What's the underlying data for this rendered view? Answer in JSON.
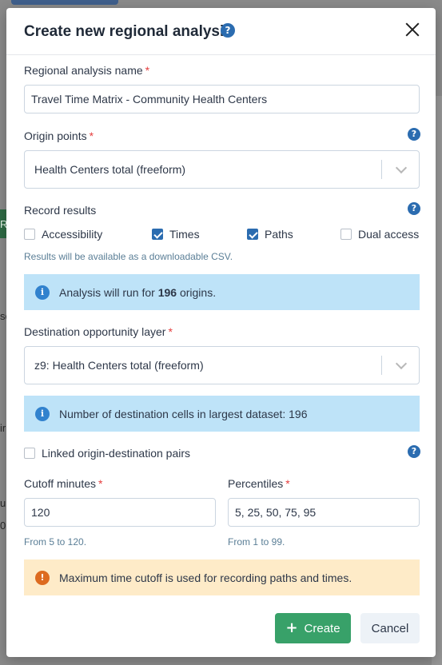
{
  "modal": {
    "title": "Create new regional analysis",
    "name_label": "Regional analysis name",
    "name_value": "Travel Time Matrix - Community Health Centers",
    "origin_label": "Origin points",
    "origin_value": "Health Centers total (freeform)",
    "record_label": "Record results",
    "checkboxes": [
      {
        "label": "Accessibility",
        "checked": false
      },
      {
        "label": "Times",
        "checked": true
      },
      {
        "label": "Paths",
        "checked": true
      },
      {
        "label": "Dual access",
        "checked": false
      }
    ],
    "record_hint": "Results will be available as a downloadable CSV.",
    "origins_info_prefix": "Analysis will run for ",
    "origins_info_count": "196",
    "origins_info_suffix": " origins.",
    "destination_label": "Destination opportunity layer",
    "destination_value": "z9: Health Centers total (freeform)",
    "destination_info": "Number of destination cells in largest dataset: 196",
    "linked_label": "Linked origin-destination pairs",
    "cutoff_label": "Cutoff minutes",
    "cutoff_value": "120",
    "cutoff_hint": "From 5 to 120.",
    "percentiles_label": "Percentiles",
    "percentiles_value": "5, 25, 50, 75, 95",
    "percentiles_hint": "From 1 to 99.",
    "warning": "Maximum time cutoff is used for recording paths and times.",
    "create_label": "Create",
    "cancel_label": "Cancel",
    "required_mark": "*",
    "help_glyph": "?",
    "info_glyph": "i",
    "warn_glyph": "!"
  },
  "background": {
    "fragments": [
      "R",
      "se",
      "ir",
      "ul",
      "0"
    ]
  },
  "colors": {
    "primary": "#2b6cb0",
    "success": "#38a169",
    "info_bg": "#bee3f8",
    "warn_bg": "#feebc8",
    "required": "#e53e3e"
  }
}
